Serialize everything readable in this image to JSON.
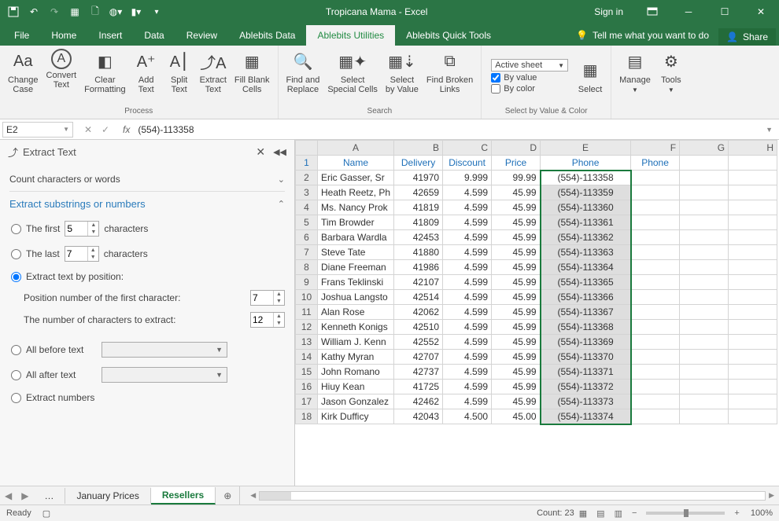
{
  "titlebar": {
    "title": "Tropicana Mama - Excel",
    "signin": "Sign in"
  },
  "tabs": [
    "File",
    "Home",
    "Insert",
    "Data",
    "Review",
    "Ablebits Data",
    "Ablebits Utilities",
    "Ablebits Quick Tools"
  ],
  "active_tab": "Ablebits Utilities",
  "tell_me": "Tell me what you want to do",
  "share": "Share",
  "ribbon": {
    "process": {
      "label": "Process",
      "change_case": "Change\nCase",
      "convert_text": "Convert\nText",
      "clear_formatting": "Clear\nFormatting",
      "add_text": "Add\nText",
      "split_text": "Split\nText",
      "extract_text": "Extract\nText",
      "fill_blank": "Fill Blank\nCells"
    },
    "search": {
      "label": "Search",
      "find_replace": "Find and\nReplace",
      "select_special": "Select\nSpecial Cells",
      "select_by_value": "Select\nby Value",
      "find_broken": "Find Broken\nLinks"
    },
    "sbvc": {
      "label": "Select by Value & Color",
      "active_sheet": "Active sheet",
      "by_value": "By value",
      "by_color": "By color",
      "select": "Select"
    },
    "manage": "Manage",
    "tools": "Tools"
  },
  "formula": {
    "name": "E2",
    "value": "(554)-113358"
  },
  "pane": {
    "title": "Extract Text",
    "count": "Count characters or words",
    "section": "Extract substrings or numbers",
    "first": "The first",
    "first_n": "5",
    "characters": "characters",
    "last": "The last",
    "last_n": "7",
    "by_pos": "Extract text by position:",
    "pos_first": "Position number of the first character:",
    "pos_first_n": "7",
    "num_extract": "The number of characters to extract:",
    "num_extract_n": "12",
    "all_before": "All before text",
    "all_after": "All after text",
    "extract_num": "Extract numbers"
  },
  "columns": [
    "",
    "A",
    "B",
    "C",
    "D",
    "E",
    "F",
    "G",
    "H"
  ],
  "headers": {
    "A": "Name",
    "B": "Delivery",
    "C": "Discount",
    "D": "Price",
    "E": "Phone",
    "F": "Phone"
  },
  "rows": [
    {
      "n": 2,
      "A": "Eric Gasser, Sr",
      "B": "41970",
      "C": "9.999",
      "D": "99.99",
      "E": "(554)-113358"
    },
    {
      "n": 3,
      "A": "Heath Reetz, Ph",
      "B": "42659",
      "C": "4.599",
      "D": "45.99",
      "E": "(554)-113359"
    },
    {
      "n": 4,
      "A": "Ms. Nancy Prok",
      "B": "41819",
      "C": "4.599",
      "D": "45.99",
      "E": "(554)-113360"
    },
    {
      "n": 5,
      "A": "Tim Browder",
      "B": "41809",
      "C": "4.599",
      "D": "45.99",
      "E": "(554)-113361"
    },
    {
      "n": 6,
      "A": "Barbara Wardla",
      "B": "42453",
      "C": "4.599",
      "D": "45.99",
      "E": "(554)-113362"
    },
    {
      "n": 7,
      "A": "Steve Tate",
      "B": "41880",
      "C": "4.599",
      "D": "45.99",
      "E": "(554)-113363"
    },
    {
      "n": 8,
      "A": "Diane Freeman",
      "B": "41986",
      "C": "4.599",
      "D": "45.99",
      "E": "(554)-113364"
    },
    {
      "n": 9,
      "A": "Frans Teklinski",
      "B": "42107",
      "C": "4.599",
      "D": "45.99",
      "E": "(554)-113365"
    },
    {
      "n": 10,
      "A": "Joshua Langsto",
      "B": "42514",
      "C": "4.599",
      "D": "45.99",
      "E": "(554)-113366"
    },
    {
      "n": 11,
      "A": "Alan Rose",
      "B": "42062",
      "C": "4.599",
      "D": "45.99",
      "E": "(554)-113367"
    },
    {
      "n": 12,
      "A": "Kenneth Konigs",
      "B": "42510",
      "C": "4.599",
      "D": "45.99",
      "E": "(554)-113368"
    },
    {
      "n": 13,
      "A": "William J. Kenn",
      "B": "42552",
      "C": "4.599",
      "D": "45.99",
      "E": "(554)-113369"
    },
    {
      "n": 14,
      "A": "Kathy Myran",
      "B": "42707",
      "C": "4.599",
      "D": "45.99",
      "E": "(554)-113370"
    },
    {
      "n": 15,
      "A": "John Romano",
      "B": "42737",
      "C": "4.599",
      "D": "45.99",
      "E": "(554)-113371"
    },
    {
      "n": 16,
      "A": "Hiuy Kean",
      "B": "41725",
      "C": "4.599",
      "D": "45.99",
      "E": "(554)-113372"
    },
    {
      "n": 17,
      "A": "Jason Gonzalez",
      "B": "42462",
      "C": "4.599",
      "D": "45.99",
      "E": "(554)-113373"
    },
    {
      "n": 18,
      "A": "Kirk Dufficy",
      "B": "42043",
      "C": "4.500",
      "D": "45.00",
      "E": "(554)-113374"
    }
  ],
  "sheets": {
    "prev": "January Prices",
    "active": "Resellers",
    "dots": "…"
  },
  "status": {
    "ready": "Ready",
    "count": "Count: 23",
    "zoom": "100%"
  }
}
